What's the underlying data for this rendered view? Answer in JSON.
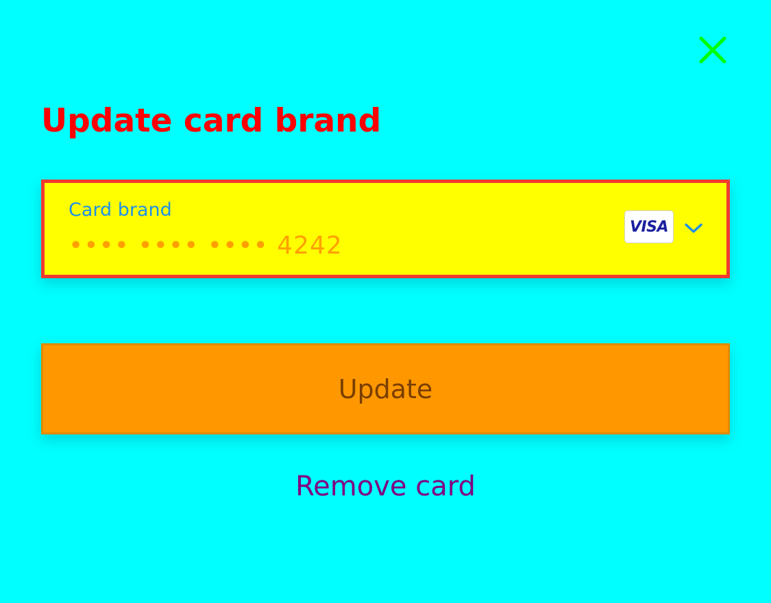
{
  "dialog": {
    "title": "Update card brand",
    "close_icon": "close-icon"
  },
  "card_field": {
    "label": "Card brand",
    "masked_number": "•••• •••• •••• 4242",
    "brand_logo_text": "VISA",
    "brand_icon": "visa-logo-icon",
    "dropdown_icon": "chevron-down-icon"
  },
  "actions": {
    "update_label": "Update",
    "remove_label": "Remove card"
  },
  "colors": {
    "background": "#00FFFF",
    "title": "#FF0000",
    "close_icon": "#00FF00",
    "field_background": "#FFFF00",
    "field_border": "#F13A30",
    "field_label": "#1E90E6",
    "card_number": "#FFA000",
    "update_button": "#FF9800",
    "update_text": "#7A3E00",
    "remove_link": "#800080"
  }
}
